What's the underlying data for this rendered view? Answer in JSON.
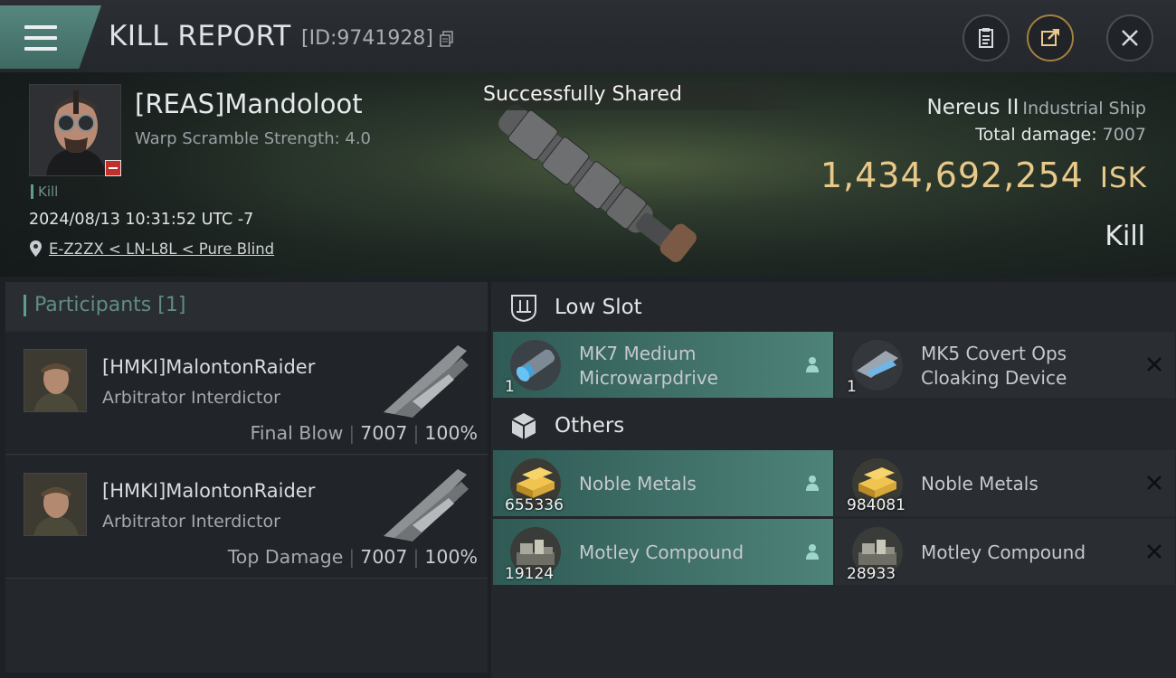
{
  "header": {
    "title": "KILL REPORT",
    "id_text": "[ID:9741928]"
  },
  "victim": {
    "name": "[REAS]Mandoloot",
    "warp_scramble": "Warp Scramble Strength: 4.0",
    "kill_tag": "Kill",
    "datetime": "2024/08/13 10:31:52 UTC -7",
    "location": "E-Z2ZX < LN-L8L < Pure Blind"
  },
  "toast": "Successfully Shared",
  "ship": {
    "name": "Nereus II",
    "class": "Industrial Ship",
    "total_damage_label": "Total damage:",
    "total_damage": "7007",
    "isk_value": "1,434,692,254",
    "isk_unit": "ISK",
    "result": "Kill"
  },
  "participants": {
    "label": "Participants",
    "count": "[1]",
    "rows": [
      {
        "name": "[HMKI]MalontonRaider",
        "ship": "Arbitrator Interdictor",
        "role": "Final Blow",
        "damage": "7007",
        "percent": "100%"
      },
      {
        "name": "[HMKI]MalontonRaider",
        "ship": "Arbitrator Interdictor",
        "role": "Top Damage",
        "damage": "7007",
        "percent": "100%"
      }
    ]
  },
  "low_slot": {
    "label": "Low Slot",
    "items": [
      {
        "line1": "MK7 Medium",
        "line2": "Microwarpdrive",
        "qty": "1",
        "state": "dropped"
      },
      {
        "line1": "MK5 Covert Ops",
        "line2": "Cloaking Device",
        "qty": "1",
        "state": "destroyed"
      }
    ]
  },
  "others": {
    "label": "Others",
    "items": [
      {
        "name": "Noble Metals",
        "qty": "655336",
        "state": "dropped"
      },
      {
        "name": "Noble Metals",
        "qty": "984081",
        "state": "destroyed"
      },
      {
        "name": "Motley Compound",
        "qty": "19124",
        "state": "dropped"
      },
      {
        "name": "Motley Compound",
        "qty": "28933",
        "state": "destroyed"
      }
    ]
  },
  "colors": {
    "accent_teal": "#4e8379",
    "isk_gold": "#e8c98a",
    "loss_red": "#c2302c"
  }
}
